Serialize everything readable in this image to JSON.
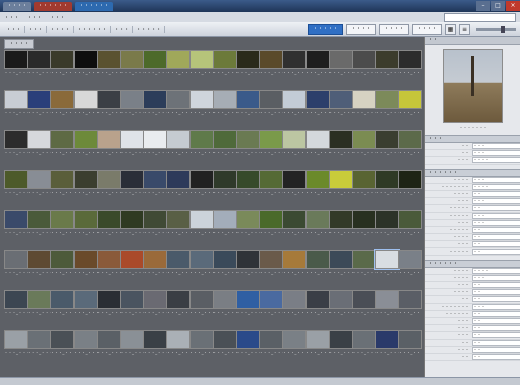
{
  "titlebar": {
    "tabs": [
      "・・・・",
      "・・・・・・",
      "・・・・・・"
    ]
  },
  "menubar": {
    "items": [
      "・・・",
      "・・・",
      "・・・"
    ],
    "search_placeholder": ""
  },
  "toolbar": {
    "breadcrumbs": [
      "・・・",
      "・・・",
      "・・・・",
      "・・・・・・",
      "・・・",
      "・・・・・"
    ],
    "buttons": [
      "・・・・",
      "・・・・",
      "・・・・"
    ],
    "primary_button": "・・・・・"
  },
  "grid": {
    "tab_label": "・・・・"
  },
  "thumb_caption": "・・・_・・・",
  "sidebar": {
    "header": "・・",
    "preview_caption": "・・・・・・・",
    "sections": [
      {
        "title": "・・・",
        "rows": [
          [
            "・・",
            "・・・"
          ],
          [
            "・・",
            "・・・"
          ],
          [
            "・・・",
            "・・・・"
          ]
        ]
      },
      {
        "title": "・・・・・・",
        "rows": [
          [
            "・・・・",
            "・・・"
          ],
          [
            "・・・・・・・",
            "・・・・"
          ],
          [
            "・・・・",
            "・・"
          ],
          [
            "・・・",
            "・・・"
          ],
          [
            "・・・・・",
            "・・"
          ],
          [
            "・・・・・",
            "・・・"
          ],
          [
            "・・・",
            "・・・"
          ],
          [
            "・・・・・",
            "・・"
          ],
          [
            "・・・・",
            "・・"
          ],
          [
            "・・・",
            "・・"
          ],
          [
            "・・・・・",
            "・・"
          ]
        ]
      },
      {
        "title": "・・・・・・",
        "rows": [
          [
            "・・・・",
            "・・・・"
          ],
          [
            "・・・・",
            "・・・"
          ],
          [
            "・・・",
            "・・"
          ],
          [
            "・・・・",
            "・・"
          ],
          [
            "・・",
            "・・"
          ],
          [
            "・・・・・・・",
            "・・・"
          ],
          [
            "・・・・・・",
            "・・"
          ],
          [
            "・・・",
            "・・"
          ],
          [
            "・・・",
            "・・"
          ],
          [
            "・・・",
            "・・"
          ],
          [
            "・・",
            "・・"
          ],
          [
            "・・・",
            "・・"
          ],
          [
            "・・",
            "・・"
          ]
        ]
      }
    ]
  },
  "statusbar": {
    "text": ""
  },
  "colors": {
    "bg": "#5d6066",
    "accent": "#2f6fc4"
  },
  "rows": [
    {
      "cells": [
        "#1a1a1a",
        "#2a2a2a",
        "#3a3a2a",
        "#0e0e0e",
        "#5a5230",
        "#7a7a4a",
        "#4d6a2a",
        "#a0a85a",
        "#b6c47a",
        "#6c7a3a",
        "#2a2a1a",
        "#5a4a2a",
        "#303030",
        "#1e1e1e",
        "#6a6a6a",
        "#4c4c4c",
        "#3c3c2c",
        "#2c2c2c"
      ]
    },
    {
      "cells": [
        "#c8cdd4",
        "#2a3f7a",
        "#8a6a3a",
        "#d8d8d8",
        "#3b3f45",
        "#7a8088",
        "#2c3d5a",
        "#6d7278",
        "#cfd5dc",
        "#a6adb5",
        "#3a5a8a",
        "#5a5e63",
        "#c3ccd6",
        "#2c3f6b",
        "#4f5e78",
        "#d6d2c2",
        "#7c8a5a",
        "#c6c63a"
      ]
    },
    {
      "cells": [
        "#2c2c2c",
        "#d6d8dc",
        "#5e6a44",
        "#6d8a3a",
        "#b9a28c",
        "#dfe3e8",
        "#e9ecef",
        "#c5cbd1",
        "#5f7a4a",
        "#4f6a3a",
        "#6a7a52",
        "#7a9a4a",
        "#bcc6a2",
        "#d4d8dc",
        "#2b2f22",
        "#7b8c52",
        "#3a3e30",
        "#5c6a4a"
      ]
    },
    {
      "cells": [
        "#4d5a2a",
        "#888d95",
        "#5a5e3a",
        "#3b3e2f",
        "#7a7b6a",
        "#2a2e38",
        "#394a6a",
        "#2d3a5a",
        "#212121",
        "#2f3a2a",
        "#364a2a",
        "#556a35",
        "#232323",
        "#6b8a2a",
        "#c9cc3a",
        "#596432",
        "#2f3a25",
        "#1e2415"
      ]
    },
    {
      "cells": [
        "#3a4a6a",
        "#4a5a3a",
        "#6a7a4a",
        "#5a6a3a",
        "#3a4a2a",
        "#2f3a22",
        "#404a35",
        "#595f45",
        "#ccd3da",
        "#a3adba",
        "#7a8a5a",
        "#4a6a2a",
        "#3b4a32",
        "#6a7a5a",
        "#333a28",
        "#283020",
        "#2c3328",
        "#4a5a3a"
      ]
    },
    {
      "cells": [
        "#6a6e74",
        "#5e4a32",
        "#4d5a3a",
        "#6a4a2a",
        "#8a5a3a",
        "#aa4a2a",
        "#9a6a3a",
        "#4a5a6a",
        "#5a6a7a",
        "#3a4a5a",
        "#2f3338",
        "#6a5a4a",
        "#a67a3a",
        "#4a5a4a",
        "#3c4a58",
        "#5a6a4a",
        "#d8dde2",
        "#7a8088"
      ]
    },
    {
      "cells": [
        "#3c4652",
        "#6a7a5a",
        "#4a5a6a",
        "#5a6a7a",
        "#2a2e34",
        "#4a5460",
        "#6a6a72",
        "#3a3e44",
        "#5a5e64",
        "#7a7e84",
        "#2f5fa3",
        "#4a6aa0",
        "#7a7e86",
        "#3a3e46",
        "#6a6e76",
        "#4a4e56",
        "#8a8e96",
        "#5a5e66"
      ]
    },
    {
      "cells": [
        "#9aa0a6",
        "#6a7076",
        "#4a5056",
        "#7a8086",
        "#5a6066",
        "#8a9096",
        "#3a4046",
        "#aab0b6",
        "#6a7076",
        "#4a5056",
        "#2a4a8a",
        "#5a6066",
        "#7a8086",
        "#9aa0a6",
        "#3a4046",
        "#6a7076",
        "#2a3a6a",
        "#5a6066"
      ]
    }
  ]
}
